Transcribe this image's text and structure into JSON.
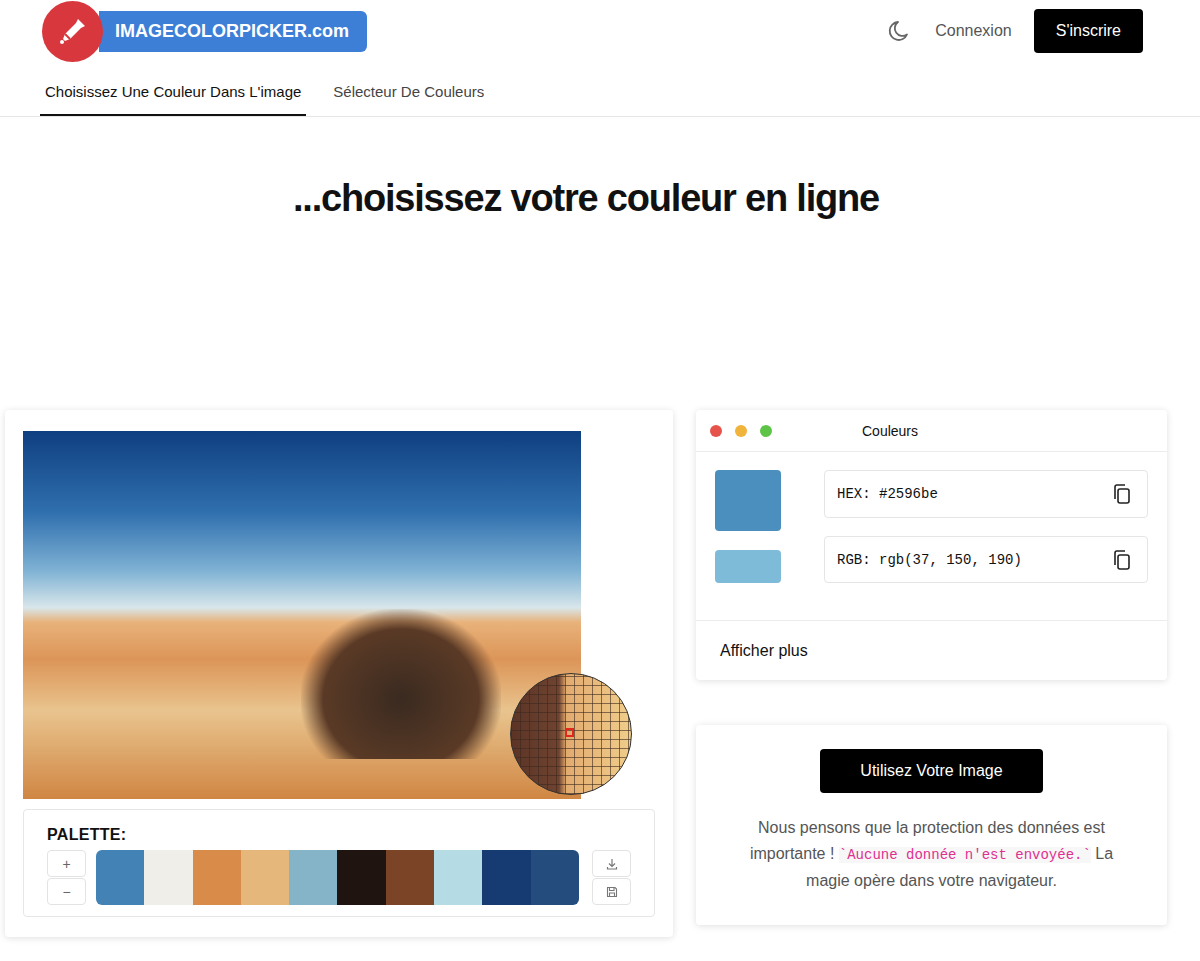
{
  "logo": {
    "text": "IMAGECOLORPICKER.com"
  },
  "header": {
    "login": "Connexion",
    "signup": "S'inscrire"
  },
  "tabs": [
    {
      "label": "Choisissez Une Couleur Dans L'image",
      "selected": true
    },
    {
      "label": "Sélecteur De Couleurs",
      "selected": false
    }
  ],
  "heading": "...choisissez votre couleur en ligne",
  "palette": {
    "title": "PALETTE:",
    "add": "+",
    "remove": "−",
    "swatches": [
      {
        "color": "#4282b5"
      },
      {
        "color": "#efeee8"
      },
      {
        "color": "#d98c4a"
      },
      {
        "color": "#e6b77a"
      },
      {
        "color": "#85b3c8"
      },
      {
        "color": "#1f140f"
      },
      {
        "color": "#7c4427"
      },
      {
        "color": "#b5dbe5"
      },
      {
        "color": "#163a72"
      },
      {
        "color": "#244c7c"
      }
    ]
  },
  "colors_panel": {
    "title": "Couleurs",
    "current_color": "#4a8fbe",
    "hover_color": "#7ebbd9",
    "hex": "HEX: #2596be",
    "rgb": "RGB: rgb(37, 150, 190)",
    "more": "Afficher plus"
  },
  "upload": {
    "button": "Utilisez Votre Image",
    "note_before": "Nous pensons que la protection des données est importante ! ",
    "note_code": "`Aucune donnée n'est envoyée.`",
    "note_after": " La magie opère dans votre navigateur."
  }
}
